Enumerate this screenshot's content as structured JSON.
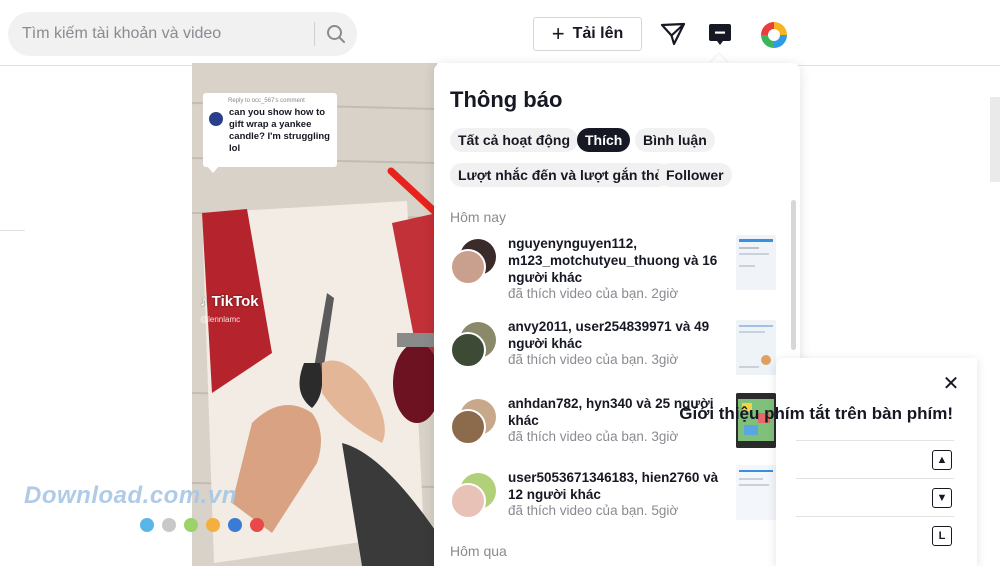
{
  "search": {
    "placeholder": "Tìm kiếm tài khoản và video"
  },
  "header": {
    "upload_label": "Tải lên"
  },
  "video": {
    "comment_reply_to": "Reply to occ_567's comment",
    "comment_text": "can you show how to gift wrap a yankee candle? I'm struggling lol",
    "brand": "TikTok",
    "username": "@lennlamc"
  },
  "notifications": {
    "title": "Thông báo",
    "filters": [
      {
        "label": "Tất cả hoạt động",
        "active": false
      },
      {
        "label": "Thích",
        "active": true
      },
      {
        "label": "Bình luận",
        "active": false
      },
      {
        "label": "Lượt nhắc đến và lượt gắn thẻ",
        "active": false
      },
      {
        "label": "Follower",
        "active": false
      }
    ],
    "section_today": "Hôm nay",
    "section_yesterday": "Hôm qua",
    "items": [
      {
        "text": "nguyenynguyen112, m123_motchutyeu_thuong và 16 người khác",
        "sub": "đã thích video của bạn. 2giờ"
      },
      {
        "text": "anvy2011, user254839971 và 49 người khác",
        "sub": "đã thích video của bạn. 3giờ"
      },
      {
        "text": "anhdan782, hyn340 và 25 người khác",
        "sub": "đã thích video của bạn. 3giờ"
      },
      {
        "text": "user5053671346183, hien2760 và 12 người khác",
        "sub": "đã thích video của bạn. 5giờ"
      }
    ]
  },
  "shortcuts": {
    "title": "Giới thiệu phím tắt trên bàn phím!",
    "keys": [
      "▲",
      "▼",
      "L"
    ]
  },
  "watermark": {
    "text": "Download.com.vn",
    "dot_colors": [
      "#5bb6e8",
      "#c8c8c8",
      "#9ad36a",
      "#f3b03f",
      "#3a7bd5",
      "#e84a4a"
    ]
  },
  "colors": {
    "accent": "#fe2c55",
    "arrow": "#e8221c",
    "dark": "#161823",
    "muted": "#8a8b91"
  }
}
